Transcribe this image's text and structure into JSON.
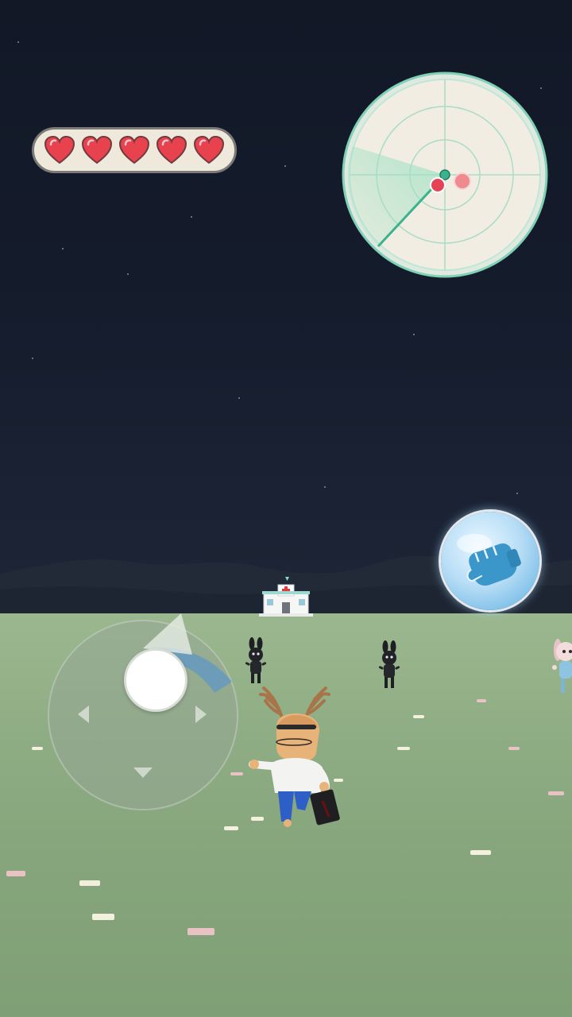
{
  "hud": {
    "health": {
      "current": 5,
      "max": 5,
      "heart_color": "#e8424f"
    },
    "radar": {
      "ring_color": "#7ed1b4",
      "background_color": "#f1ede2",
      "sweep_color": "#9ee1c2",
      "player_marker_color": "#3bb28e",
      "enemy_marker_color": "#e54355",
      "enemy_faded_marker_color": "#ef8a8f"
    },
    "attack_button": {
      "icon": "fist-icon",
      "accent_color": "#3b97c9"
    },
    "joystick": {
      "icon": "joystick-knob",
      "direction_indicator_color": "#4b8fd8"
    }
  },
  "scene": {
    "time_of_day": "night",
    "landmark": "hospital",
    "player_character": "deer-antler-doctor",
    "enemies": [
      "black-rabbit-zombie",
      "black-rabbit-zombie",
      "pink-bunny-girl"
    ]
  }
}
